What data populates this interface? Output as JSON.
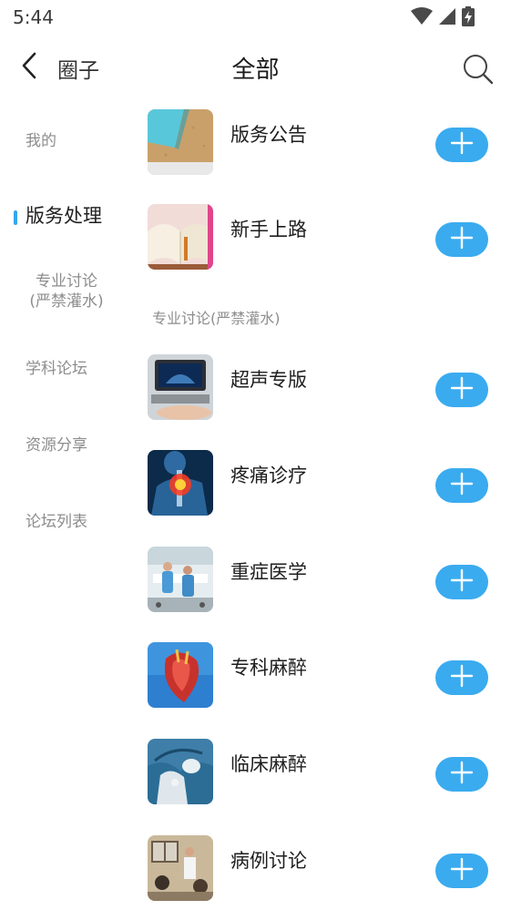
{
  "status_bar": {
    "time": "5:44",
    "icons": [
      "wifi-icon",
      "signal-icon",
      "battery-charging-icon"
    ]
  },
  "header": {
    "back_label": "圈子",
    "title": "全部",
    "back_icon": "chevron-left-icon",
    "search_icon": "search-icon"
  },
  "sidebar": {
    "items": [
      {
        "label": "我的",
        "active": false
      },
      {
        "label": "版务处理",
        "active": true
      },
      {
        "label": "专业讨论(严禁灌水)",
        "line1": "专业讨论",
        "line2": "(严禁灌水)",
        "active": false
      },
      {
        "label": "学科论坛",
        "active": false
      },
      {
        "label": "资源分享",
        "active": false
      },
      {
        "label": "论坛列表",
        "active": false
      }
    ]
  },
  "sections": [
    {
      "heading": "",
      "forums": [
        {
          "name": "版务公告"
        },
        {
          "name": "新手上路"
        }
      ]
    },
    {
      "heading": "专业讨论(严禁灌水)",
      "forums": [
        {
          "name": "超声专版"
        },
        {
          "name": "疼痛诊疗"
        },
        {
          "name": "重症医学"
        },
        {
          "name": "专科麻醉"
        },
        {
          "name": "临床麻醉"
        },
        {
          "name": "病例讨论"
        }
      ]
    }
  ],
  "colors": {
    "accent": "#3aabef",
    "indicator": "#35a6ea",
    "muted_text": "#8d8d8d"
  }
}
